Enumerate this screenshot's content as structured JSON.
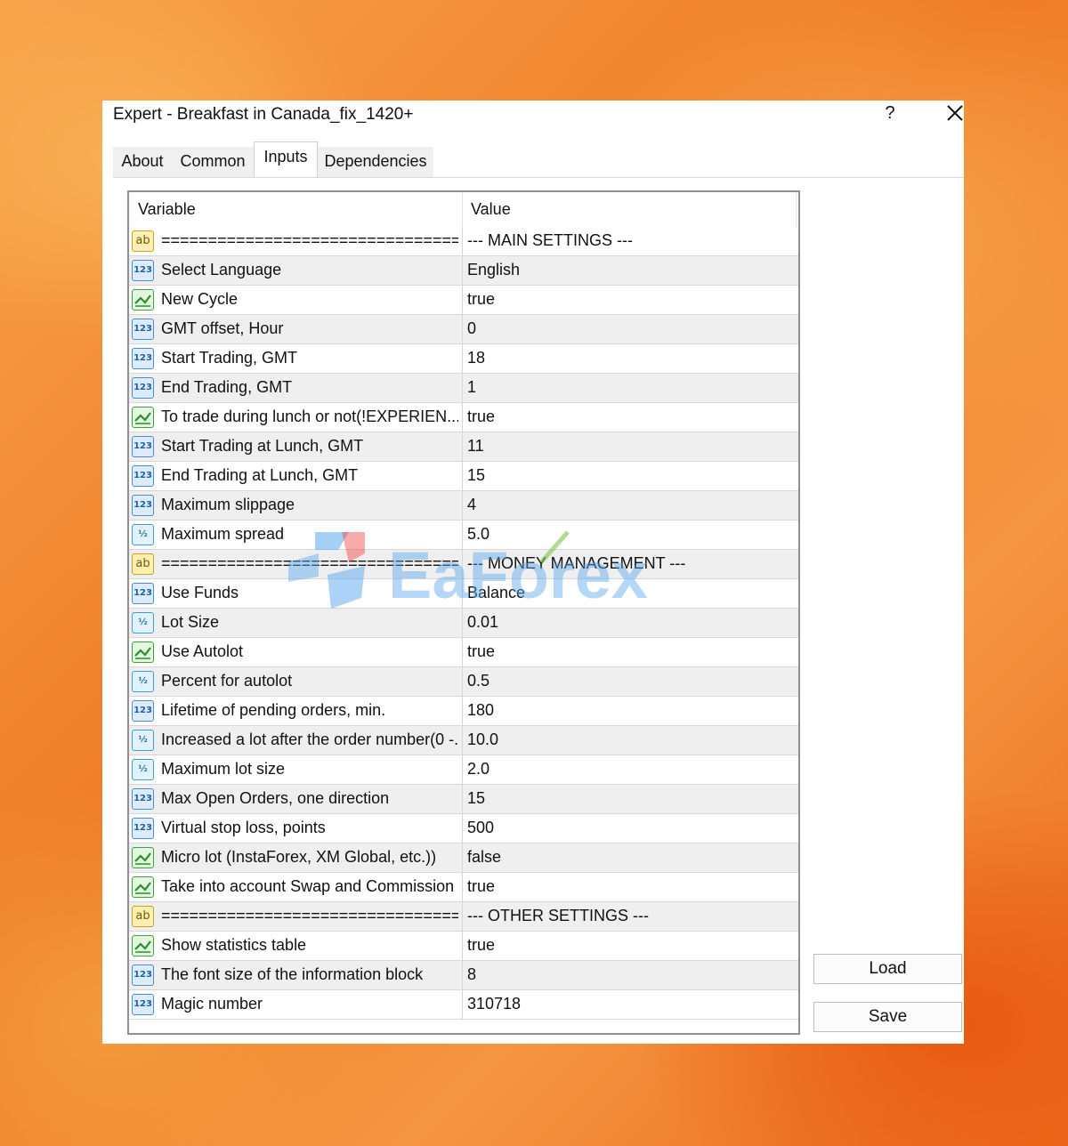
{
  "window": {
    "title": "Expert - Breakfast in Canada_fix_1420+",
    "help_label": "?",
    "close_icon": "close-icon"
  },
  "tabs": [
    {
      "label": "About"
    },
    {
      "label": "Common"
    },
    {
      "label": "Inputs",
      "active": true
    },
    {
      "label": "Dependencies"
    }
  ],
  "grid": {
    "header": {
      "variable": "Variable",
      "value": "Value"
    },
    "rows": [
      {
        "type": "string",
        "variable": "================================",
        "value": "--- MAIN SETTINGS ---"
      },
      {
        "type": "int",
        "variable": "Select Language",
        "value": "English"
      },
      {
        "type": "bool",
        "variable": "New Cycle",
        "value": "true"
      },
      {
        "type": "int",
        "variable": "GMT offset, Hour",
        "value": "0"
      },
      {
        "type": "int",
        "variable": "Start Trading, GMT",
        "value": "18"
      },
      {
        "type": "int",
        "variable": "End Trading, GMT",
        "value": "1"
      },
      {
        "type": "bool",
        "variable": "To trade during lunch or not(!EXPERIEN...",
        "value": "true"
      },
      {
        "type": "int",
        "variable": "Start Trading at Lunch, GMT",
        "value": "11"
      },
      {
        "type": "int",
        "variable": "End Trading at Lunch, GMT",
        "value": "15"
      },
      {
        "type": "int",
        "variable": "Maximum slippage",
        "value": "4"
      },
      {
        "type": "double",
        "variable": "Maximum spread",
        "value": "5.0"
      },
      {
        "type": "string",
        "variable": "================================",
        "value": "--- MONEY MANAGEMENT ---"
      },
      {
        "type": "int",
        "variable": "Use Funds",
        "value": "Balance"
      },
      {
        "type": "double",
        "variable": "Lot Size",
        "value": "0.01"
      },
      {
        "type": "bool",
        "variable": "Use Autolot",
        "value": "true"
      },
      {
        "type": "double",
        "variable": "Percent for autolot",
        "value": "0.5"
      },
      {
        "type": "int",
        "variable": "Lifetime of pending orders, min.",
        "value": "180"
      },
      {
        "type": "double",
        "variable": "Increased a lot after the order number(0 -...",
        "value": "10.0"
      },
      {
        "type": "double",
        "variable": "Maximum lot size",
        "value": "2.0"
      },
      {
        "type": "int",
        "variable": "Max Open Orders, one direction",
        "value": "15"
      },
      {
        "type": "int",
        "variable": "Virtual stop loss, points",
        "value": "500"
      },
      {
        "type": "bool",
        "variable": "Micro lot (InstaForex, XM Global, etc.))",
        "value": "false"
      },
      {
        "type": "bool",
        "variable": "Take into account Swap and Commission",
        "value": "true"
      },
      {
        "type": "string",
        "variable": "================================",
        "value": "--- OTHER SETTINGS ---"
      },
      {
        "type": "bool",
        "variable": "Show statistics table",
        "value": "true"
      },
      {
        "type": "int",
        "variable": "The font size of the information block",
        "value": "8"
      },
      {
        "type": "int",
        "variable": "Magic number",
        "value": "310718"
      }
    ]
  },
  "icons": {
    "int": {
      "name": "integer-type-icon",
      "glyph": "123"
    },
    "double": {
      "name": "double-type-icon",
      "glyph": "½"
    },
    "string": {
      "name": "string-type-icon",
      "glyph": "ab"
    },
    "bool": {
      "name": "boolean-type-icon",
      "glyph": ""
    }
  },
  "buttons": {
    "load": "Load",
    "save": "Save"
  },
  "watermark": {
    "text": "EaForex"
  },
  "colors": {
    "background_orange": "#ef7a26",
    "row_alt": "#efefef",
    "watermark_blue": "#5aa8f0"
  }
}
